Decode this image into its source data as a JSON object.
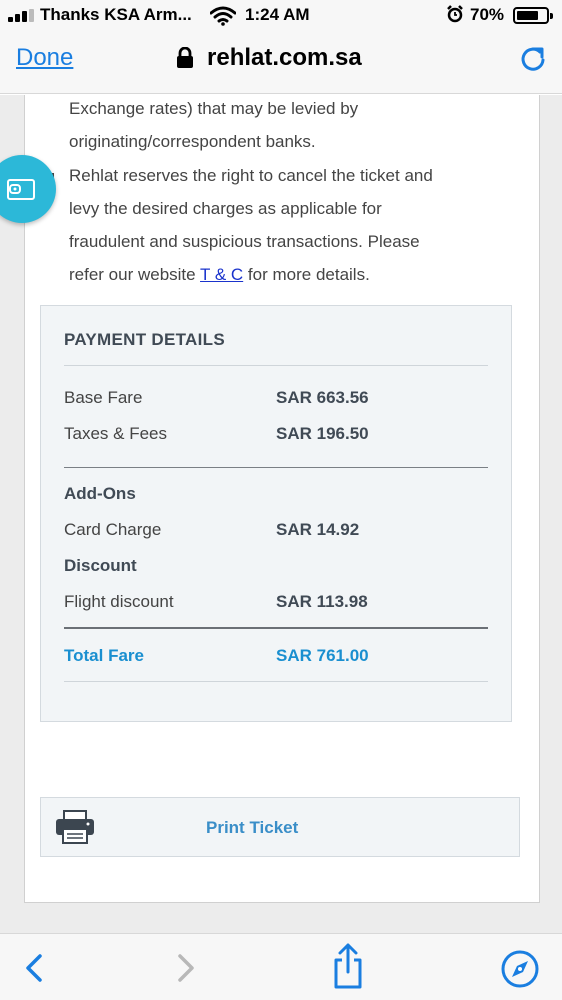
{
  "status_bar": {
    "carrier": "Thanks KSA Arm...",
    "time": "1:24 AM",
    "battery": "70%",
    "battery_level": 0.7
  },
  "nav": {
    "done_label": "Done",
    "url": "rehlat.com.sa"
  },
  "terms": {
    "line1": "Exchange rates) that may be levied by",
    "line2": "originating/correspondent banks.",
    "bullet_line1": "Rehlat reserves the right to cancel the ticket and",
    "bullet_line2": "levy the desired charges as applicable for",
    "bullet_line3": "fraudulent and suspicious transactions. Please",
    "bullet_line4_prefix": "refer our website",
    "tc_link": "T & C",
    "bullet_line4_suffix": "for more details."
  },
  "payment": {
    "title": "PAYMENT DETAILS",
    "base_fare_label": "Base Fare",
    "base_fare_value": "SAR 663.56",
    "taxes_label": "Taxes & Fees",
    "taxes_value": "SAR 196.50",
    "addons_label": "Add-Ons",
    "card_charge_label": "Card Charge",
    "card_charge_value": "SAR 14.92",
    "discount_label": "Discount",
    "flight_discount_label": "Flight discount",
    "flight_discount_value": "SAR 113.98",
    "total_label": "Total Fare",
    "total_value": "SAR 761.00"
  },
  "print": {
    "label": "Print Ticket"
  },
  "colors": {
    "link_blue": "#1a7ee0",
    "accent_blue": "#1a8fd0",
    "wallet_teal": "#2cb8d8"
  },
  "icons": [
    "signal-icon",
    "wifi-icon",
    "alarm-icon",
    "battery-icon",
    "lock-icon",
    "reload-icon",
    "wallet-icon",
    "printer-icon",
    "back-icon",
    "forward-icon",
    "share-icon",
    "compass-icon"
  ]
}
